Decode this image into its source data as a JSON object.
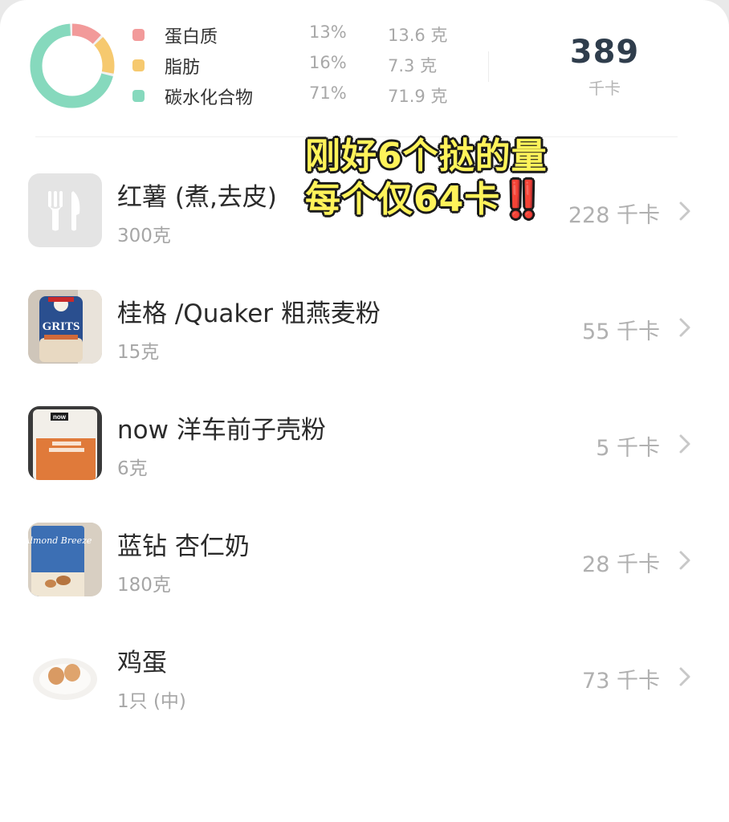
{
  "summary": {
    "total_kcal": "389",
    "kcal_unit": "千卡",
    "macros": [
      {
        "name": "蛋白质",
        "percent": "13%",
        "grams": "13.6 克",
        "fraction": 0.13,
        "color": "#f29a9a"
      },
      {
        "name": "脂肪",
        "percent": "16%",
        "grams": "7.3 克",
        "fraction": 0.16,
        "color": "#f6c96f"
      },
      {
        "name": "碳水化合物",
        "percent": "71%",
        "grams": "71.9 克",
        "fraction": 0.71,
        "color": "#86d9bd"
      }
    ]
  },
  "overlay": {
    "line1": "刚好6个挞的量",
    "line2": "每个仅64卡",
    "line2_marks": "‼️"
  },
  "foods": [
    {
      "name": "红薯 (煮,去皮)",
      "amount": "300克",
      "kcal": "228 千卡",
      "thumb": "fork-knife-icon"
    },
    {
      "name": "桂格 /Quaker 粗燕麦粉",
      "amount": "15克",
      "kcal": "55 千卡",
      "thumb": "quaker-grits-photo",
      "photo_text": "GRITS"
    },
    {
      "name": "now 洋车前子壳粉",
      "amount": "6克",
      "kcal": "5 千卡",
      "thumb": "psyllium-powder-photo",
      "photo_text": "now"
    },
    {
      "name": "蓝钻 杏仁奶",
      "amount": "180克",
      "kcal": "28 千卡",
      "thumb": "almond-breeze-photo",
      "photo_text": "Almond Breeze"
    },
    {
      "name": "鸡蛋",
      "amount": "1只 (中)",
      "kcal": "73 千卡",
      "thumb": "eggs-photo"
    }
  ],
  "colors": {
    "chevron": "#c8c8c8",
    "title_dark": "#2f3d4c"
  }
}
